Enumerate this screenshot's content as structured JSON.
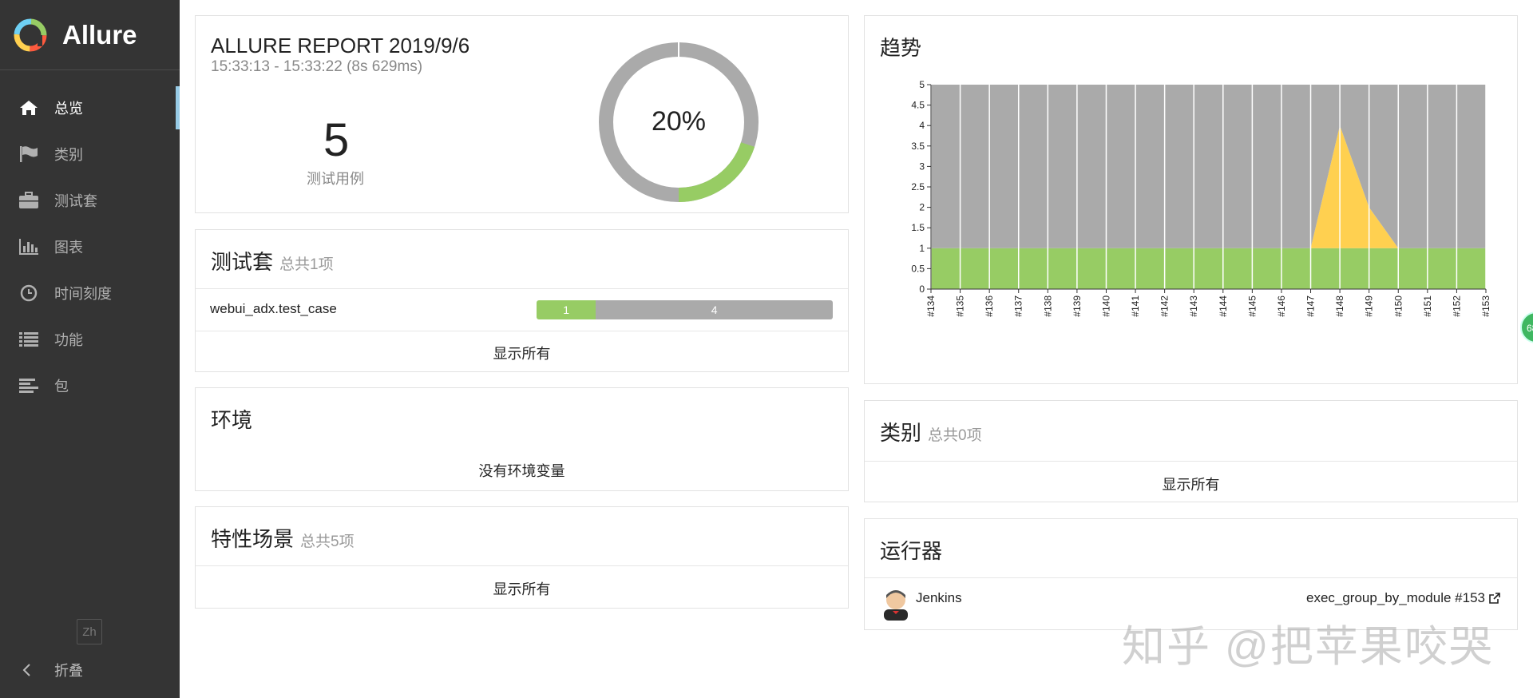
{
  "sidebar": {
    "brand": "Allure",
    "items": [
      {
        "label": "总览",
        "icon": "home-icon",
        "active": true
      },
      {
        "label": "类别",
        "icon": "flag-icon",
        "active": false
      },
      {
        "label": "测试套",
        "icon": "briefcase-icon",
        "active": false
      },
      {
        "label": "图表",
        "icon": "bar-chart-icon",
        "active": false
      },
      {
        "label": "时间刻度",
        "icon": "clock-icon",
        "active": false
      },
      {
        "label": "功能",
        "icon": "list-icon",
        "active": false
      },
      {
        "label": "包",
        "icon": "align-left-icon",
        "active": false
      }
    ],
    "lang": "Zh",
    "collapse": "折叠"
  },
  "summary": {
    "title": "ALLURE REPORT 2019/9/6",
    "time": "15:33:13 - 15:33:22 (8s 629ms)",
    "count": "5",
    "count_label": "测试用例",
    "percent": "20%",
    "passed_fraction": 0.2,
    "colors": {
      "passed": "#97cc64",
      "unknown": "#aaaaaa"
    }
  },
  "suites": {
    "title": "测试套",
    "subtitle": "总共1项",
    "rows": [
      {
        "name": "webui_adx.test_case",
        "passed": "1",
        "other": "4"
      }
    ],
    "show_all": "显示所有"
  },
  "environment": {
    "title": "环境",
    "empty": "没有环境变量"
  },
  "features": {
    "title": "特性场景",
    "subtitle": "总共5项",
    "show_all": "显示所有"
  },
  "trend": {
    "title": "趋势"
  },
  "categories": {
    "title": "类别",
    "subtitle": "总共0项",
    "show_all": "显示所有"
  },
  "executors": {
    "title": "运行器",
    "name": "Jenkins",
    "build": "exec_group_by_module #153"
  },
  "watermark": "知乎 @把苹果咬哭",
  "badge": "68",
  "chart_data": {
    "type": "area",
    "title": "趋势",
    "categories": [
      "#134",
      "#135",
      "#136",
      "#137",
      "#138",
      "#139",
      "#140",
      "#141",
      "#142",
      "#143",
      "#144",
      "#145",
      "#146",
      "#147",
      "#148",
      "#149",
      "#150",
      "#151",
      "#152",
      "#153"
    ],
    "series": [
      {
        "values": [
          1,
          1,
          1,
          1,
          1,
          1,
          1,
          1,
          1,
          1,
          1,
          1,
          1,
          1,
          1,
          1,
          1,
          1,
          1,
          1
        ],
        "color": "#97cc64"
      },
      {
        "values": [
          0,
          0,
          0,
          0,
          0,
          0,
          0,
          0,
          0,
          0,
          0,
          0,
          0,
          0,
          3,
          1,
          0,
          0,
          0,
          0
        ],
        "color": "#ffd050"
      },
      {
        "values": [
          4,
          4,
          4,
          4,
          4,
          4,
          4,
          4,
          4,
          4,
          4,
          4,
          4,
          4,
          1,
          3,
          4,
          4,
          4,
          4
        ],
        "color": "#aaaaaa"
      }
    ],
    "yticks": [
      "0",
      "0.5",
      "1",
      "1.5",
      "2",
      "2.5",
      "3",
      "3.5",
      "4",
      "4.5",
      "5"
    ],
    "ylim": [
      0,
      5
    ],
    "grid": true,
    "legend": "none"
  }
}
